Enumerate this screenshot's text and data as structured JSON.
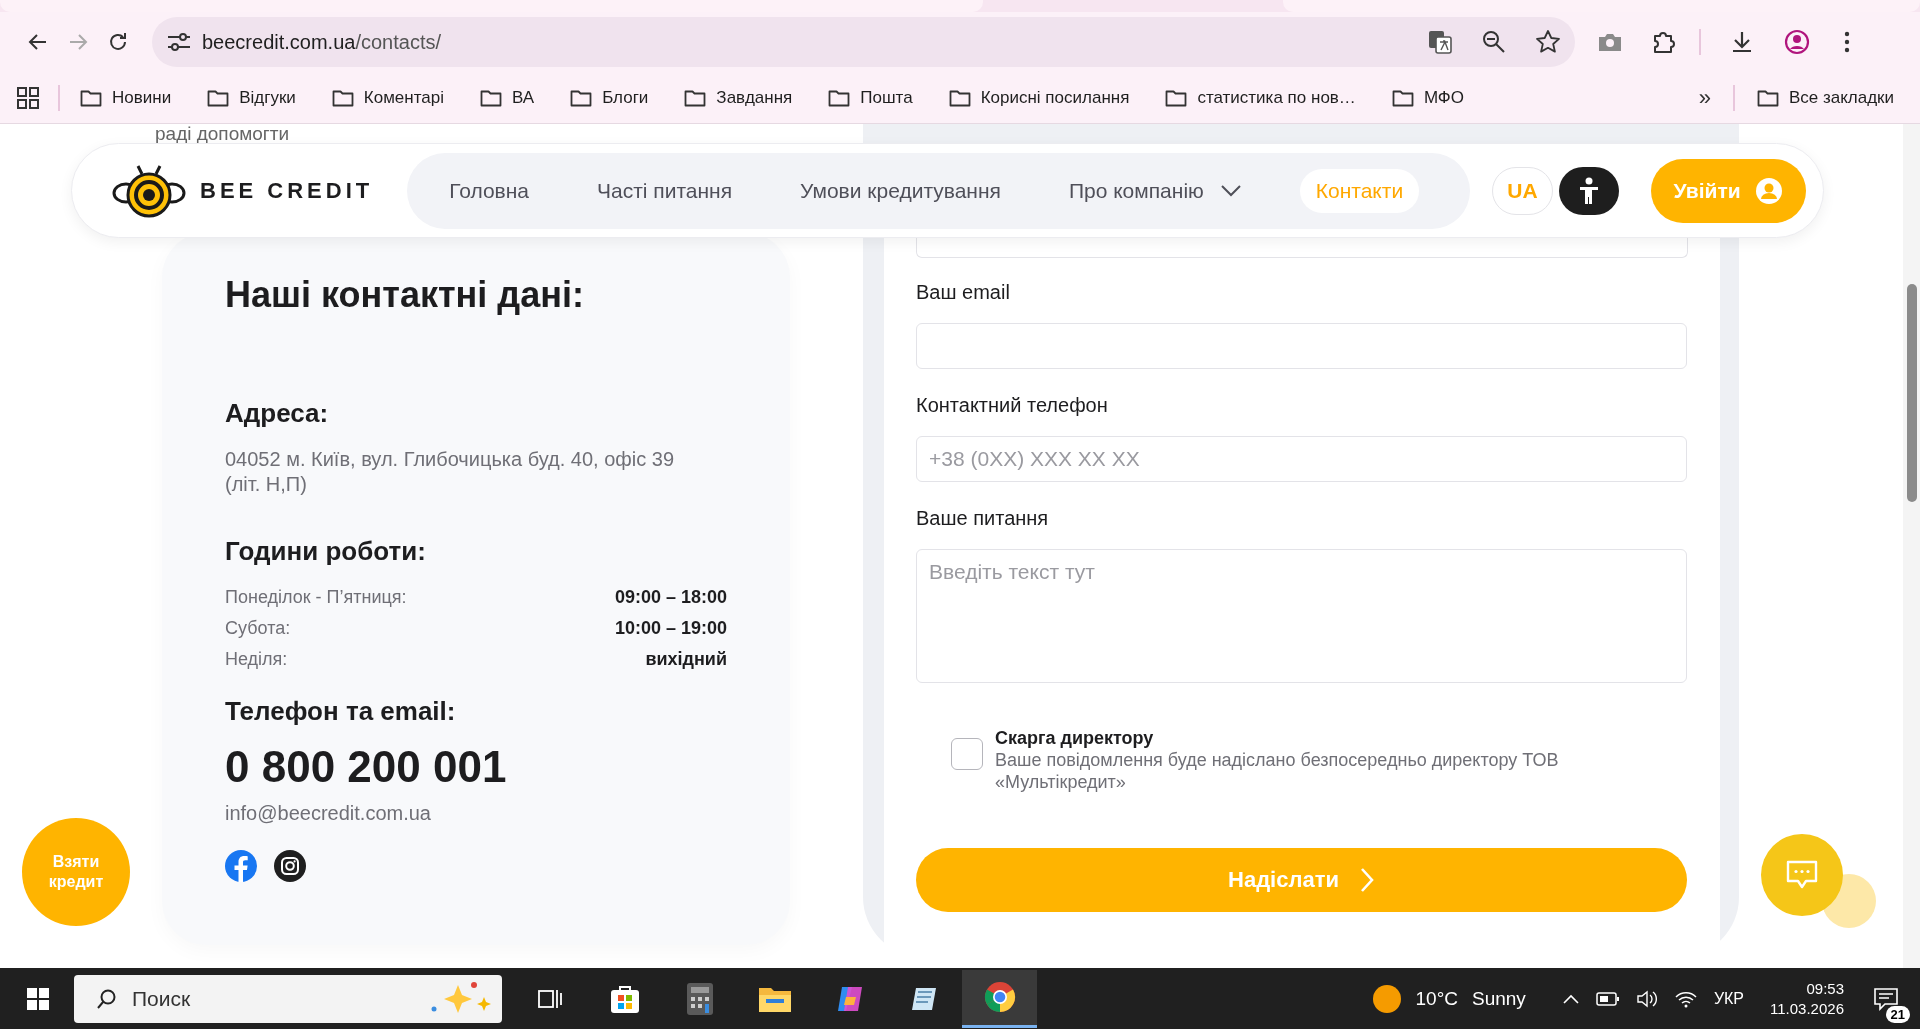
{
  "browser": {
    "url_host": "beecredit.com.ua",
    "url_path": "/contacts/",
    "bookmarks": [
      "Новини",
      "Відгуки",
      "Коментарі",
      "ВА",
      "Блоги",
      "Завдання",
      "Пошта",
      "Корисні посилання",
      "статистика по нов…",
      "МФО"
    ],
    "overflow": "»",
    "all_bookmarks": "Все закладки"
  },
  "page": {
    "partial_text": "раді допомогти",
    "header": {
      "logo": "BEE CREDIT",
      "nav": [
        {
          "label": "Головна",
          "selected": false,
          "kind": "link"
        },
        {
          "label": "Часті питання",
          "selected": false,
          "kind": "link"
        },
        {
          "label": "Умови кредитування",
          "selected": false,
          "kind": "link"
        },
        {
          "label": "Про компанію",
          "selected": false,
          "kind": "dropdown"
        },
        {
          "label": "Контакти",
          "selected": true,
          "kind": "link"
        }
      ],
      "language": "UA",
      "login": "Увійти"
    },
    "contacts": {
      "title": "Наші контактні дані:",
      "address_heading": "Адреса:",
      "address": "04052 м. Київ, вул. Глибочицька буд. 40, офіс 39 (літ. Н,П)",
      "hours_heading": "Години роботи:",
      "hours": [
        {
          "day": "Понеділок - П’ятниця:",
          "time": "09:00 – 18:00"
        },
        {
          "day": "Субота:",
          "time": "10:00 – 19:00"
        },
        {
          "day": "Неділя:",
          "time": "вихідний"
        }
      ],
      "phone_heading": "Телефон та email:",
      "phone": "0 800 200 001",
      "email": "info@beecredit.com.ua"
    },
    "form": {
      "fields": [
        {
          "label": "Ваш email",
          "kind": "input"
        },
        {
          "label": "Контактний телефон",
          "kind": "input",
          "placeholder": "+38 (0XX) XXX XX XX"
        },
        {
          "label": "Ваше питання",
          "kind": "textarea",
          "placeholder": "Введіть текст тут"
        }
      ],
      "complaint": {
        "checked": false,
        "title": "Скарга директору",
        "description": "Ваше повідомлення буде надіслано безпосередньо директору ТОВ «Мультікредит»"
      },
      "submit": "Надіслати"
    },
    "take_credit": "Взяти кредит"
  },
  "taskbar": {
    "search_placeholder": "Поиск",
    "temperature": "10°C",
    "weather": "Sunny",
    "language": "УКР",
    "time": "09:53",
    "date": "11.03.2026",
    "notifications": "21"
  }
}
